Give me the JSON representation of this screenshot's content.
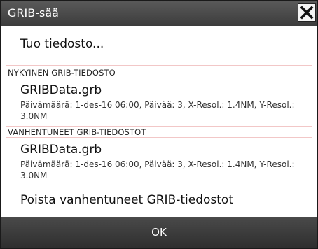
{
  "dialog": {
    "title": "GRIB-sää",
    "close_icon": "close-icon"
  },
  "actions": {
    "import_label": "Tuo tiedosto...",
    "delete_expired_label": "Poista vanhentuneet GRIB-tiedostot"
  },
  "current_section": {
    "header": "NYKYINEN GRIB-TIEDOSTO",
    "file": {
      "name": "GRIBData.grb",
      "details": "Päivämäärä: 1-des-16 06:00, Päivää: 3, X-Resol.: 1.4NM, Y-Resol.: 3.0NM"
    }
  },
  "expired_section": {
    "header": "VANHENTUNEET GRIB-TIEDOSTOT",
    "file": {
      "name": "GRIBData.grb",
      "details": "Päivämäärä: 1-des-16 06:00, Päivää: 3, X-Resol.: 1.4NM, Y-Resol.: 3.0NM"
    }
  },
  "footer": {
    "ok_label": "OK"
  },
  "colors": {
    "titlebar": "#4a4a4a",
    "separator": "#f2c7c7",
    "footer": "#3a3a3a"
  }
}
